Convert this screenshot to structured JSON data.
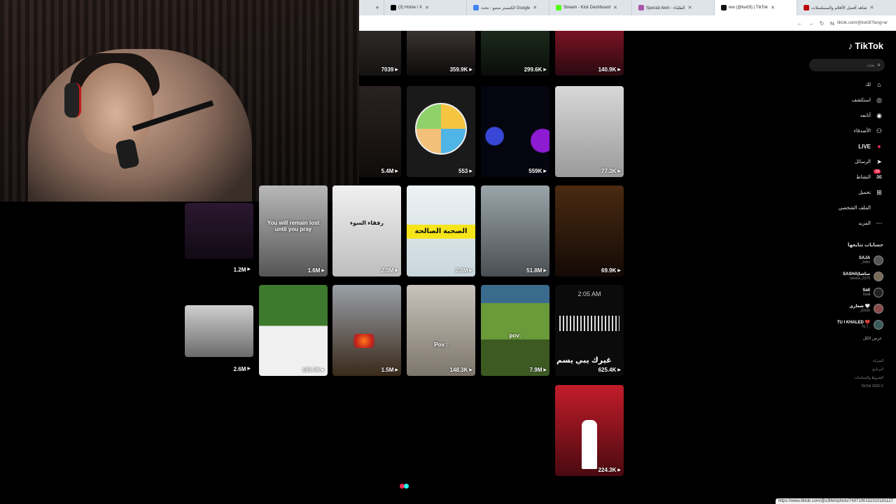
{
  "browser": {
    "tabs": [
      {
        "title": "شاهد أفضل الأفلام والمسلسلات",
        "active": false
      },
      {
        "title": "ww (@kwt3l) | TikTok",
        "active": true
      },
      {
        "title": "Special Alert - الطلباء",
        "active": false
      },
      {
        "title": "Stream - Kick Dashboard",
        "active": false
      },
      {
        "title": "الكنستر ستيو - بحث Google",
        "active": false
      },
      {
        "title": "(3) Home / X",
        "active": false
      }
    ],
    "new_tab": "+",
    "address": "tiktok.com/@kwt3l?lang=ar"
  },
  "sidebar": {
    "logo": "TikTok",
    "search_placeholder": "بحث",
    "nav": [
      {
        "label": "لك",
        "icon": "home-icon",
        "glyph": "⌂"
      },
      {
        "label": "استكشف",
        "icon": "compass-icon",
        "glyph": "◎"
      },
      {
        "label": "أتابعه",
        "icon": "following-icon",
        "glyph": "◉"
      },
      {
        "label": "الأصدقاء",
        "icon": "friends-icon",
        "glyph": "⚇"
      },
      {
        "label": "LIVE",
        "icon": "live-icon",
        "glyph": "●"
      },
      {
        "label": "الرسائل",
        "icon": "messages-icon",
        "glyph": "➤"
      },
      {
        "label": "النشاط",
        "icon": "activity-icon",
        "glyph": "✉",
        "badge": "13"
      },
      {
        "label": "تحميل",
        "icon": "upload-icon",
        "glyph": "⊞"
      },
      {
        "label": "الملف الشخصي",
        "icon": "profile-icon",
        "glyph": ""
      },
      {
        "label": "المزيد",
        "icon": "more-icon",
        "glyph": "⋯"
      }
    ],
    "following_title": "حسابات تتابعها",
    "accounts": [
      {
        "name": "SAJA",
        "handle": "_fshiv"
      },
      {
        "name": "SASHA|ساشا",
        "handle": "ssssss_2375"
      },
      {
        "name": "Sall",
        "handle": "0sall"
      },
      {
        "name": "شعاري 🤍",
        "handle": "_v2x2e"
      },
      {
        "name": "TU I KHALED 💔",
        "handle": "7k.7_"
      }
    ],
    "see_all": "عرض الكل",
    "footer": [
      "الشركة",
      "البرنامج",
      "الشروط والسياسات",
      "TikTok 2026 ©"
    ]
  },
  "videos": [
    {
      "views": "7039"
    },
    {
      "views": "359.9K"
    },
    {
      "views": "299.6K"
    },
    {
      "views": "140.9K"
    },
    {
      "views": "5.4M"
    },
    {
      "views": "553"
    },
    {
      "views": "559K"
    },
    {
      "views": "77.3K"
    },
    {
      "views": "1.2M"
    },
    {
      "views": "1.6M",
      "caption": "You will remain lost until you pray"
    },
    {
      "views": "2.3M",
      "caption": "رفقاء السوء"
    },
    {
      "views": "2.3M",
      "caption": "الصحبة الصالحة"
    },
    {
      "views": "51.8M"
    },
    {
      "views": "69.9K"
    },
    {
      "views": "2.6M"
    },
    {
      "views": "199.7K"
    },
    {
      "views": "1.5M"
    },
    {
      "views": "148.3K",
      "caption": "Pov :"
    },
    {
      "views": "7.9M",
      "caption": "pov:"
    },
    {
      "views": "625.4K",
      "time": "2:05 AM",
      "caption": "غيرك يبي يسم"
    },
    {
      "views": "224.3K"
    }
  ],
  "status_url": "https://www.tiktok.com/@x3lfeh/photo/7497190152310181127"
}
